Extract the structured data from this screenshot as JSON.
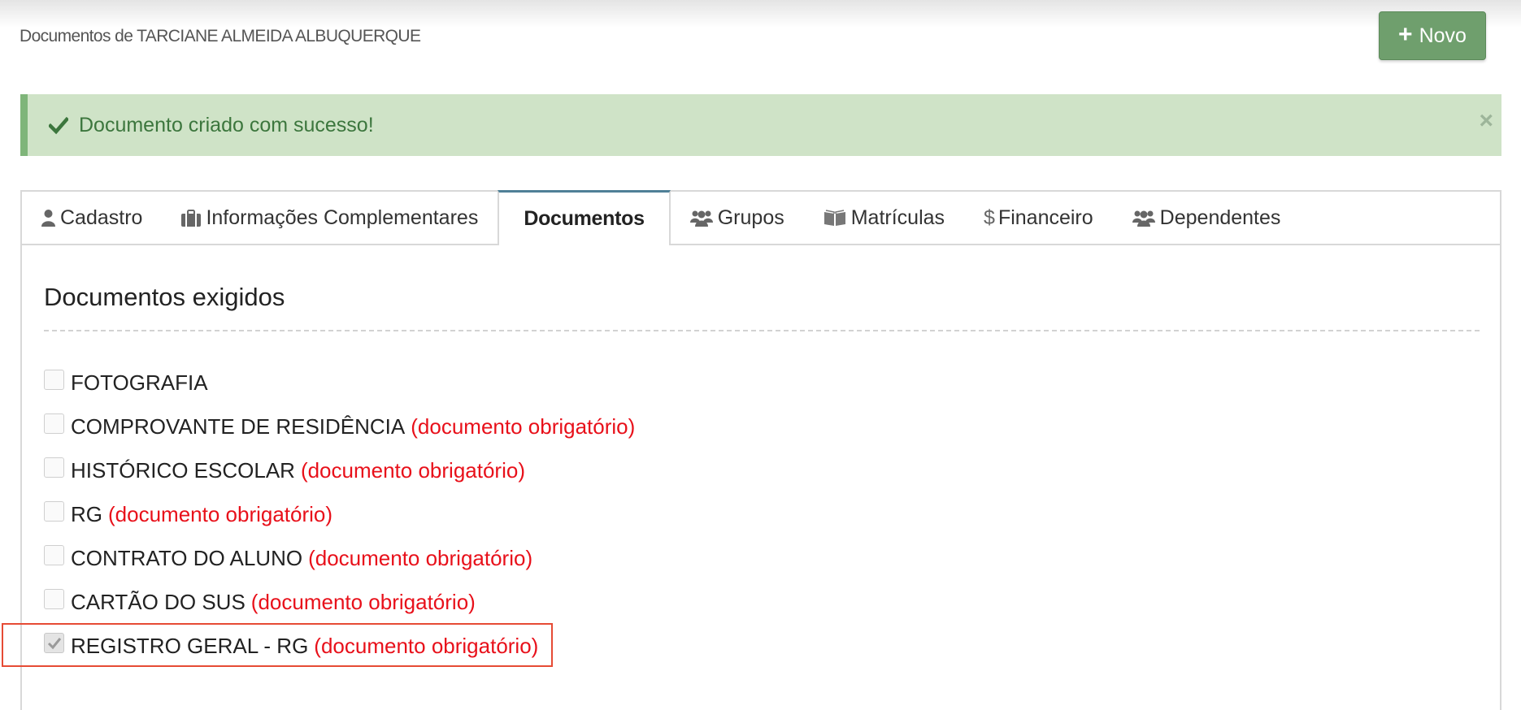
{
  "header": {
    "title": "Documentos de TARCIANE ALMEIDA ALBUQUERQUE",
    "new_button_label": "Novo"
  },
  "alert": {
    "message": "Documento criado com sucesso!",
    "close_symbol": "×",
    "color": "#3c763d"
  },
  "tabs": [
    {
      "label": "Cadastro",
      "icon": "user-icon",
      "active": false
    },
    {
      "label": "Informações Complementares",
      "icon": "briefcase-icon",
      "active": false
    },
    {
      "label": "Documentos",
      "icon": "",
      "active": true
    },
    {
      "label": "Grupos",
      "icon": "users-icon",
      "active": false
    },
    {
      "label": "Matrículas",
      "icon": "book-icon",
      "active": false
    },
    {
      "label": "Financeiro",
      "icon": "dollar-icon",
      "active": false
    },
    {
      "label": "Dependentes",
      "icon": "users-icon",
      "active": false
    }
  ],
  "section": {
    "title": "Documentos exigidos"
  },
  "documents": [
    {
      "name": "FOTOGRAFIA",
      "required_text": "",
      "checked": false
    },
    {
      "name": "COMPROVANTE DE RESIDÊNCIA",
      "required_text": "(documento obrigatório)",
      "checked": false
    },
    {
      "name": "HISTÓRICO ESCOLAR",
      "required_text": "(documento obrigatório)",
      "checked": false
    },
    {
      "name": "RG",
      "required_text": "(documento obrigatório)",
      "checked": false
    },
    {
      "name": "CONTRATO DO ALUNO",
      "required_text": "(documento obrigatório)",
      "checked": false
    },
    {
      "name": "CARTÃO DO SUS",
      "required_text": "(documento obrigatório)",
      "checked": false
    },
    {
      "name": "REGISTRO GERAL - RG",
      "required_text": "(documento obrigatório)",
      "checked": true
    }
  ],
  "colors": {
    "primary_button": "#6f9f6d",
    "alert_bg": "#cfe3c7",
    "required_text": "#e8101a",
    "active_tab_border": "#4f8097",
    "highlight_border": "#e64b35"
  }
}
